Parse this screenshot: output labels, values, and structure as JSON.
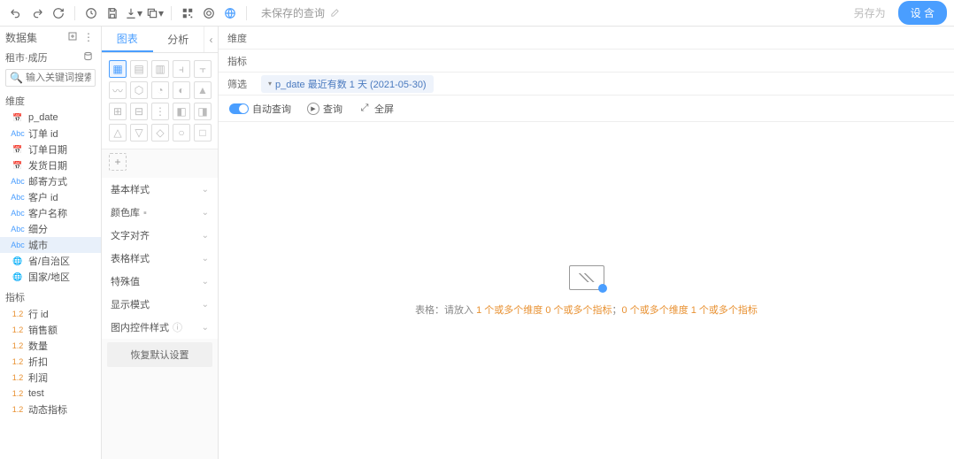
{
  "toolbar": {
    "title": "未保存的查询",
    "saveas": "另存为",
    "run": "设 含"
  },
  "sidebar": {
    "title": "数据集",
    "dataset": "租市·成历",
    "search_placeholder": "输入关键词搜索",
    "dim_section": "维度",
    "metric_section": "指标",
    "dims": [
      {
        "label": "p_date",
        "icon": "cal"
      },
      {
        "label": "订单 id",
        "icon": "abc"
      },
      {
        "label": "订单日期",
        "icon": "cal"
      },
      {
        "label": "发货日期",
        "icon": "cal"
      },
      {
        "label": "邮寄方式",
        "icon": "abc"
      },
      {
        "label": "客户 id",
        "icon": "abc"
      },
      {
        "label": "客户名称",
        "icon": "abc"
      },
      {
        "label": "细分",
        "icon": "abc"
      },
      {
        "label": "城市",
        "icon": "abc",
        "selected": true
      },
      {
        "label": "省/自治区",
        "icon": "geo"
      },
      {
        "label": "国家/地区",
        "icon": "geo"
      }
    ],
    "metrics": [
      {
        "label": "行 id"
      },
      {
        "label": "销售额"
      },
      {
        "label": "数量"
      },
      {
        "label": "折扣"
      },
      {
        "label": "利润"
      },
      {
        "label": "test"
      },
      {
        "label": "动态指标"
      }
    ]
  },
  "config": {
    "tab1": "图表",
    "tab2": "分析",
    "acc": [
      "基本样式",
      "颜色库",
      "文字对齐",
      "表格样式",
      "特殊值",
      "显示模式",
      "图内控件样式"
    ],
    "reset": "恢复默认设置"
  },
  "canvas": {
    "row1_label": "维度",
    "row2_label": "指标",
    "row3_label": "筛选",
    "filter_pill": "p_date 最近有数 1 天 (2021-05-30)",
    "opt_auto": "自动查询",
    "opt_query": "查询",
    "opt_full": "全屏",
    "empty_prefix": "表格：请放入 ",
    "empty_a": "1 个或多个维度 0 个或多个指标",
    "empty_mid": "；",
    "empty_b": "0 个或多个维度 1 个或多个指标"
  }
}
